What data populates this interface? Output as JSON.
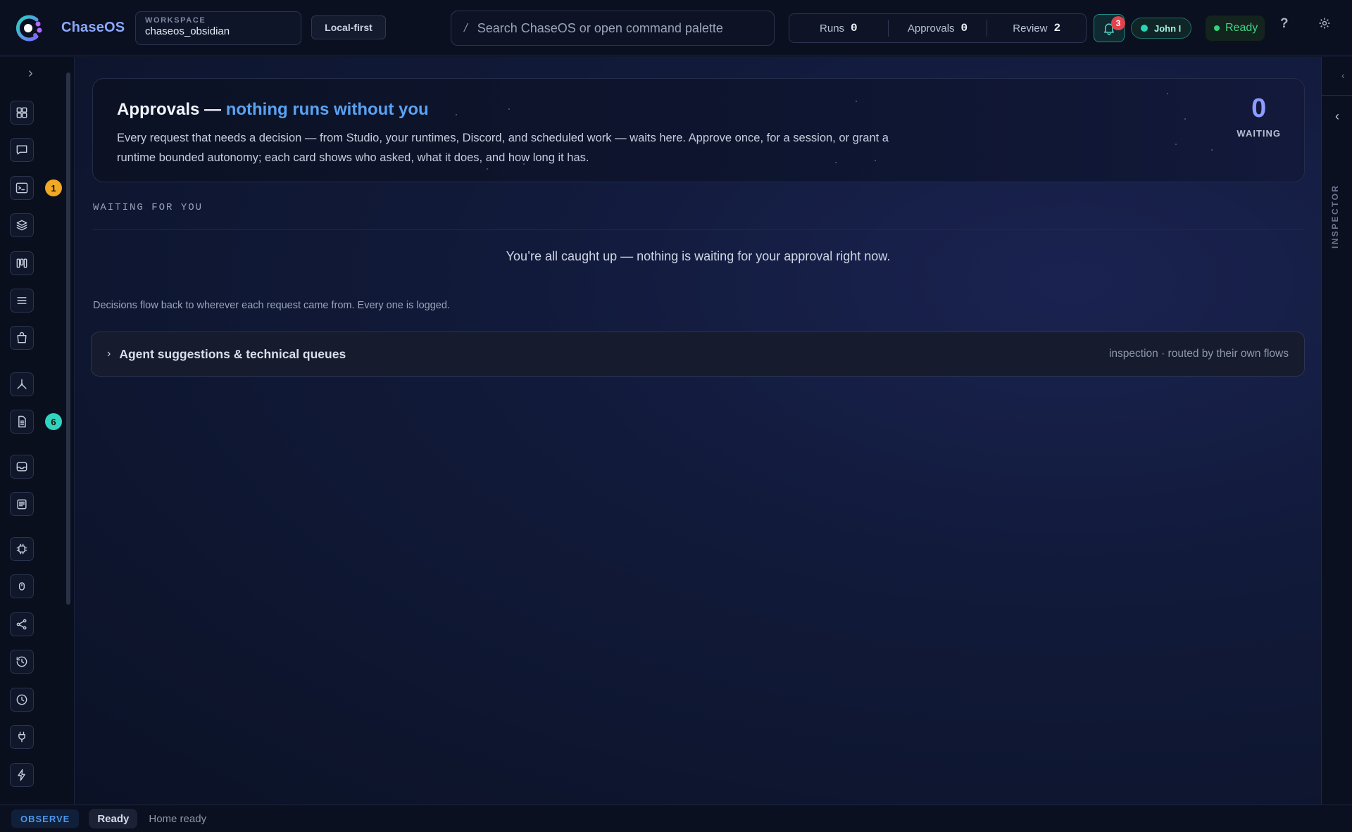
{
  "app": {
    "name": "ChaseOS"
  },
  "workspace": {
    "label": "WORKSPACE",
    "value": "chaseos_obsidian"
  },
  "mode_chip": "Local-first",
  "search": {
    "slash": "/",
    "placeholder": "Search ChaseOS or open command palette"
  },
  "stats": [
    {
      "label": "Runs",
      "value": "0"
    },
    {
      "label": "Approvals",
      "value": "0"
    },
    {
      "label": "Review",
      "value": "2"
    }
  ],
  "notifications": {
    "count": "3"
  },
  "user": {
    "name": "John I"
  },
  "status": {
    "label": "Ready"
  },
  "help_label": "?",
  "rail": {
    "items": [
      {
        "icon": "dashboard-grid-icon"
      },
      {
        "icon": "chat-icon"
      },
      {
        "icon": "terminal-icon",
        "badge": "1",
        "badge_color": "#f0a825"
      },
      {
        "icon": "layers-icon"
      },
      {
        "icon": "kanban-board-icon"
      },
      {
        "icon": "list-icon"
      },
      {
        "icon": "shopping-bag-icon"
      },
      {
        "icon": "graph-nodes-icon"
      },
      {
        "icon": "document-icon",
        "badge": "6",
        "badge_color": "#2fd3c0"
      },
      {
        "icon": "inbox-icon"
      },
      {
        "icon": "notes-stack-icon"
      },
      {
        "icon": "cpu-chip-icon"
      },
      {
        "icon": "mouse-icon"
      },
      {
        "icon": "share-icon"
      },
      {
        "icon": "history-icon"
      },
      {
        "icon": "clock-icon"
      },
      {
        "icon": "plug-icon"
      },
      {
        "icon": "lightning-icon"
      }
    ]
  },
  "hero": {
    "title_prefix": "Approvals — ",
    "title_accent": "nothing runs without you",
    "description": "Every request that needs a decision — from Studio, your runtimes, Discord, and scheduled work — waits here. Approve once, for a session, or grant a runtime bounded autonomy; each card shows who asked, what it does, and how long it has.",
    "count": "0",
    "count_label": "WAITING"
  },
  "waiting": {
    "heading": "WAITING FOR YOU",
    "empty_message": "You’re all caught up — nothing is waiting for your approval right now."
  },
  "flow_note": "Decisions flow back to wherever each request came from. Every one is logged.",
  "accordion": {
    "title": "Agent suggestions & technical queues",
    "meta": "inspection · routed by their own flows"
  },
  "inspector": {
    "label": "INSPECTOR"
  },
  "statusbar": {
    "mode": "OBSERVE",
    "state": "Ready",
    "message": "Home ready"
  },
  "colors": {
    "accent_blue": "#5aa2f2",
    "count_purple": "#8c9cff",
    "ready_green": "#3fd486",
    "notification_red": "#e0434e",
    "teal": "#2bd3b3"
  }
}
